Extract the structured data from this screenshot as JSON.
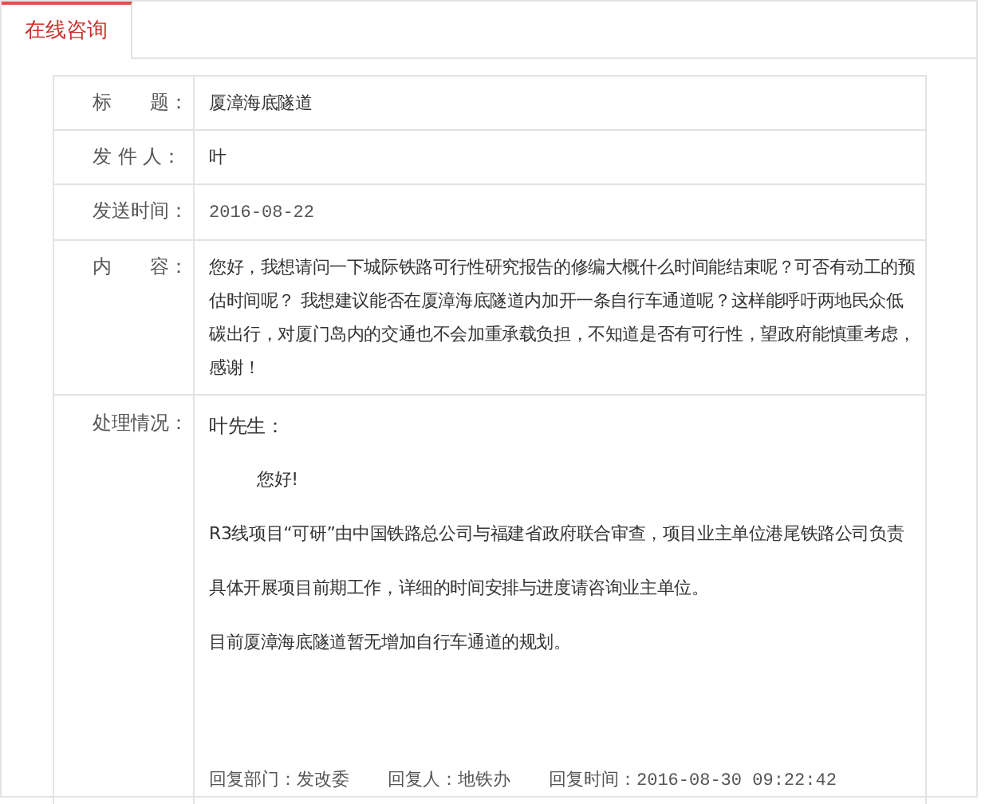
{
  "tabs": [
    {
      "label": "在线咨询",
      "selected": true
    }
  ],
  "fields": [
    {
      "label": "标　　题：",
      "value": "厦漳海底隧道",
      "kind": "text"
    },
    {
      "label": "发 件 人：",
      "value": "叶",
      "kind": "text"
    },
    {
      "label": "发送时间：",
      "value": "2016-08-22",
      "kind": "date"
    },
    {
      "label": "内　　容：",
      "value": "您好，我想请问一下城际铁路可行性研究报告的修编大概什么时间能结束呢？可否有动工的预估时间呢？ 我想建议能否在厦漳海底隧道内加开一条自行车通道呢？这样能呼吁两地民众低碳出行，对厦门岛内的交通也不会加重承载负担，不知道是否有可行性，望政府能慎重考虑，感谢！",
      "kind": "text"
    }
  ],
  "reply": {
    "label": "处理情况：",
    "greeting": "叶先生：",
    "salutation": "您好!",
    "paragraphs": [
      "R3线项目“可研”由中国铁路总公司与福建省政府联合审查，项目业主单位港尾铁路公司负责具体开展项目前期工作，详细的时间安排与进度请咨询业主单位。",
      "目前厦漳海底隧道暂无增加自行车通道的规划。"
    ],
    "footer": [
      {
        "label": "回复部门：",
        "value": "发改委",
        "kind": "text"
      },
      {
        "label": "回复人：",
        "value": "地铁办",
        "kind": "text"
      },
      {
        "label": "回复时间：",
        "value": "2016-08-30 09:22:42",
        "kind": "date"
      }
    ]
  }
}
